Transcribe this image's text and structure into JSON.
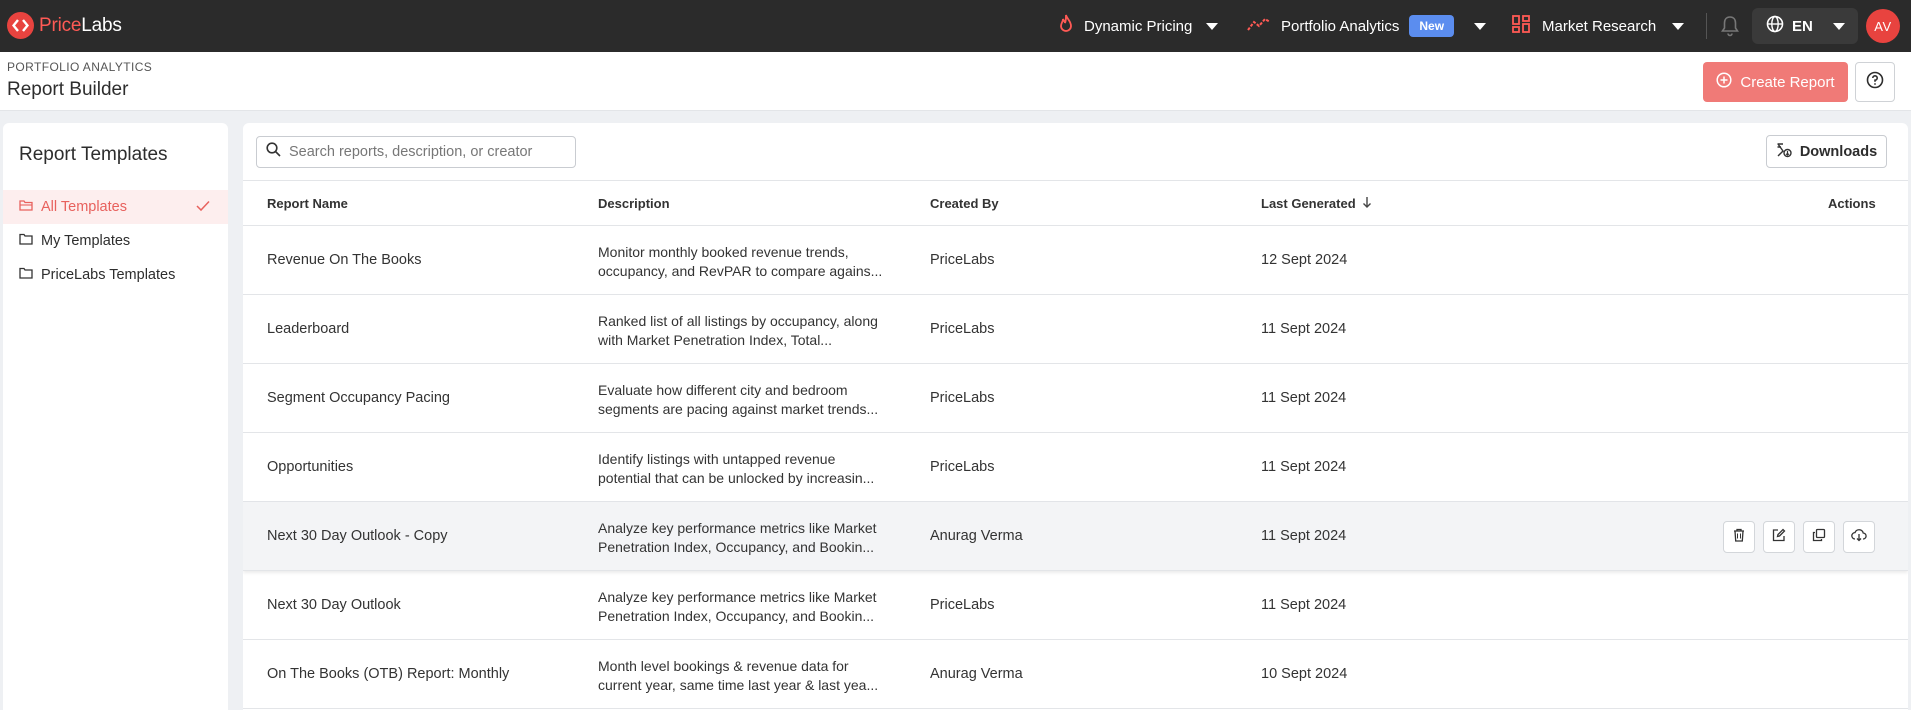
{
  "brand": {
    "name_part1": "Price",
    "name_part2": "Labs"
  },
  "nav": {
    "dynamic_pricing": "Dynamic Pricing",
    "portfolio_analytics": "Portfolio Analytics",
    "new_badge": "New",
    "market_research": "Market Research",
    "language": "EN",
    "avatar_initials": "AV"
  },
  "header": {
    "breadcrumb": "PORTFOLIO ANALYTICS",
    "title": "Report Builder",
    "create_button": "Create Report"
  },
  "sidebar": {
    "title": "Report Templates",
    "items": [
      {
        "label": "All Templates",
        "active": true
      },
      {
        "label": "My Templates",
        "active": false
      },
      {
        "label": "PriceLabs Templates",
        "active": false
      }
    ]
  },
  "toolbar": {
    "search_placeholder": "Search reports, description, or creator",
    "downloads_label": "Downloads"
  },
  "table": {
    "columns": [
      "Report Name",
      "Description",
      "Created By",
      "Last Generated",
      "Actions"
    ],
    "rows": [
      {
        "name": "Revenue On The Books",
        "desc1": "Monitor monthly booked revenue trends,",
        "desc2": "occupancy, and RevPAR to compare agains...",
        "created_by": "PriceLabs",
        "last_generated": "12 Sept 2024"
      },
      {
        "name": "Leaderboard",
        "desc1": "Ranked list of all listings by occupancy, along",
        "desc2": "with Market Penetration Index, Total...",
        "created_by": "PriceLabs",
        "last_generated": "11 Sept 2024"
      },
      {
        "name": "Segment Occupancy Pacing",
        "desc1": "Evaluate how different city and bedroom",
        "desc2": "segments are pacing against market trends...",
        "created_by": "PriceLabs",
        "last_generated": "11 Sept 2024"
      },
      {
        "name": "Opportunities",
        "desc1": "Identify listings with untapped revenue",
        "desc2": "potential that can be unlocked by increasin...",
        "created_by": "PriceLabs",
        "last_generated": "11 Sept 2024"
      },
      {
        "name": "Next 30 Day Outlook - Copy",
        "desc1": "Analyze key performance metrics like Market",
        "desc2": "Penetration Index, Occupancy, and Bookin...",
        "created_by": "Anurag Verma",
        "last_generated": "11 Sept 2024"
      },
      {
        "name": "Next 30 Day Outlook",
        "desc1": "Analyze key performance metrics like Market",
        "desc2": "Penetration Index, Occupancy, and Bookin...",
        "created_by": "PriceLabs",
        "last_generated": "11 Sept 2024"
      },
      {
        "name": "On The Books (OTB) Report: Monthly",
        "desc1": "Month level bookings & revenue data for",
        "desc2": "current year, same time last year & last yea...",
        "created_by": "Anurag Verma",
        "last_generated": "10 Sept 2024"
      }
    ],
    "hover_row_actions": [
      "trash-icon",
      "edit-icon",
      "copy-icon",
      "cloud-download-icon"
    ]
  },
  "colors": {
    "brand": "#e8433f",
    "topbar": "#2b2b2b",
    "accent_light": "#f07a77",
    "badge": "#5b8def"
  }
}
